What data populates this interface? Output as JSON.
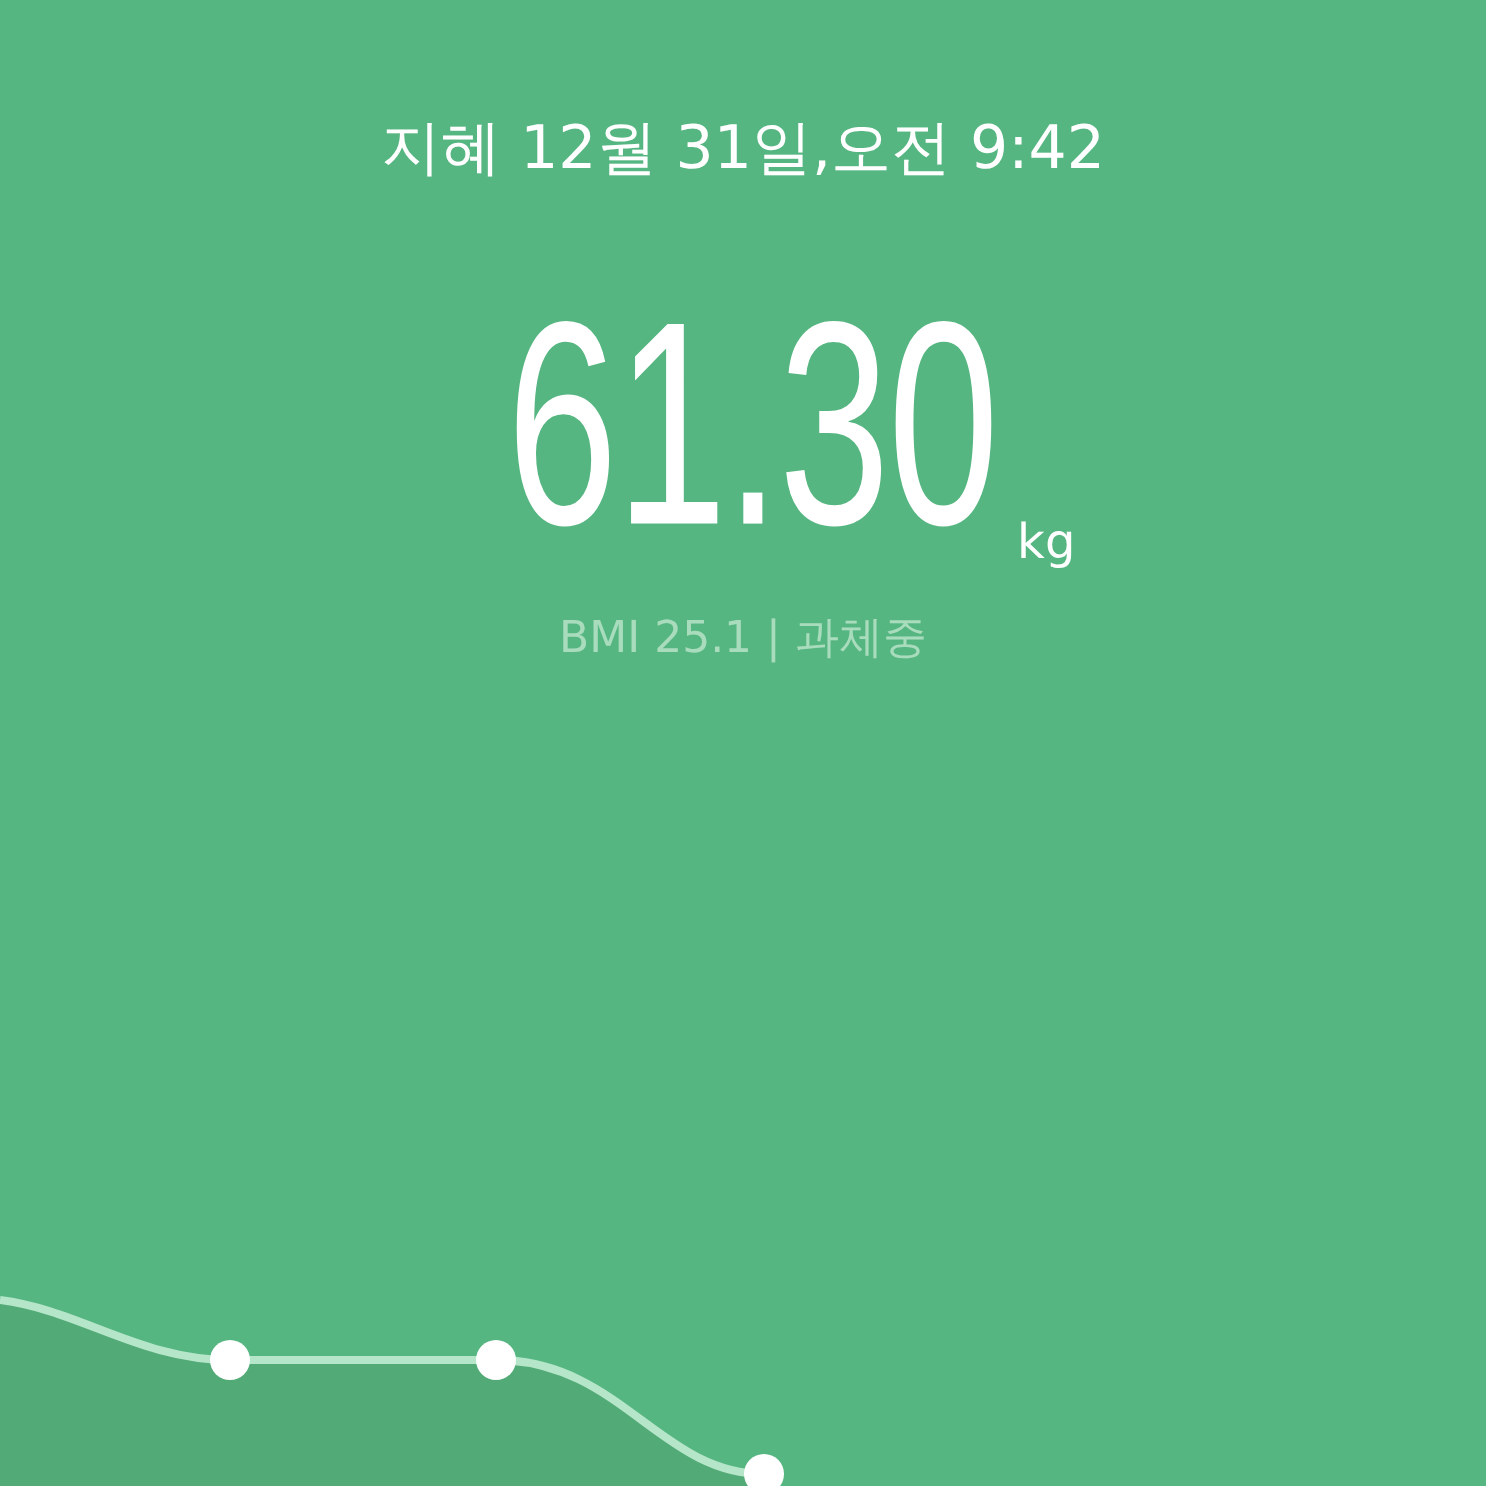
{
  "header": {
    "title": "지혜 12월 31일,오전 9:42"
  },
  "weight": {
    "value": "61.30",
    "unit": "kg"
  },
  "bmi": {
    "text": "BMI 25.1 | 과체중"
  }
}
